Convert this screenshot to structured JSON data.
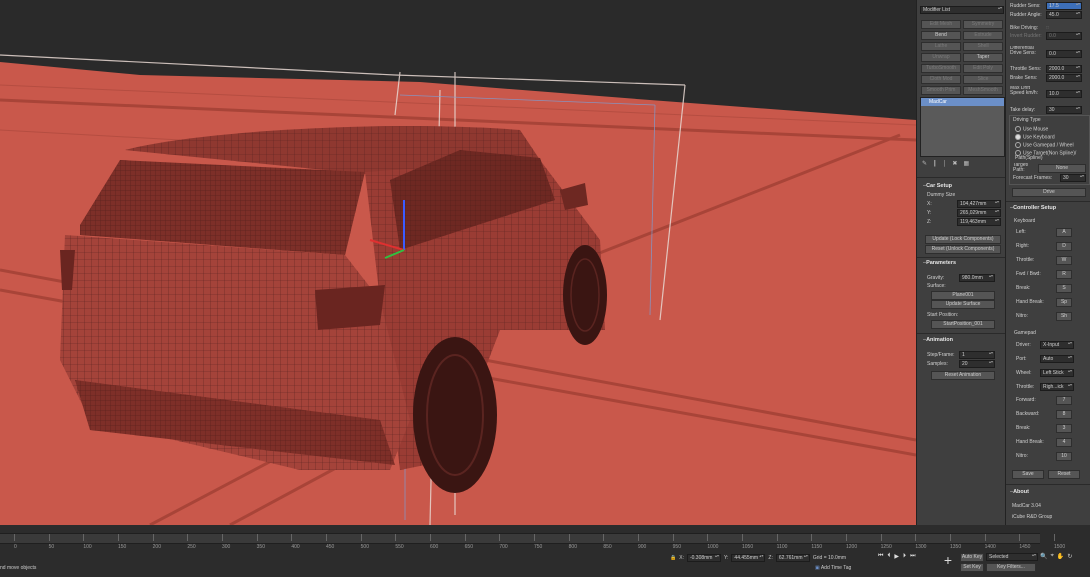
{
  "modifier_panel": {
    "modifier_list_label": "Modifier List",
    "buttons": [
      [
        "Edit Mesh",
        "Symmetry"
      ],
      [
        "Bend",
        "Extrude"
      ],
      [
        "Lathe",
        "Shell"
      ],
      [
        "Unwrap",
        "Taper"
      ],
      [
        "TurboSmooth",
        "Edit Poly"
      ],
      [
        "Cloth Mod",
        "Slice"
      ],
      [
        "Smooth Prim",
        "MeshSmooth"
      ]
    ],
    "stack_item": "MadCar",
    "car_setup": {
      "title": "Car Setup",
      "dummy_size_label": "Dummy Size",
      "x_label": "X:",
      "x_value": "104,427mm",
      "y_label": "Y:",
      "y_value": "265,029mm",
      "z_label": "Z:",
      "z_value": "119,463mm",
      "update_btn": "Update (Lock Components)",
      "reset_btn": "Reset (Unlock Components)"
    },
    "parameters": {
      "title": "Parameters",
      "gravity_label": "Gravity:",
      "gravity_value": "980.0mm",
      "surface_label": "Surface:",
      "surface_value": "Plane001",
      "update_surface_btn": "Update Surface",
      "start_position_label": "Start Position:",
      "start_position_value": "StartPosition_001"
    },
    "animation": {
      "title": "Animation",
      "step_frame_label": "Step/Frame:",
      "step_frame_value": "1",
      "samples_label": "Samples:",
      "samples_value": "20",
      "reset_btn": "Reset Animation"
    }
  },
  "right_panel": {
    "rudder_sens_label": "Rudder Sens:",
    "rudder_sens_value": "17.5",
    "rudder_angle_label": "Rudder Angle:",
    "rudder_angle_value": "45.0",
    "bike_driving_label": "Bike Driving:",
    "invert_rudder_label": "Invert Rudder:",
    "invert_rudder_value": "0.0",
    "diff_drive_label": "Differential Drive Sens:",
    "diff_drive_value": "0.0",
    "throttle_sens_label": "Throttle Sens:",
    "throttle_sens_value": "2000.0",
    "brake_sens_label": "Brake Sens:",
    "brake_sens_value": "2000.0",
    "max_drift_label": "Max Drift Speed km/h:",
    "max_drift_value": "10.0",
    "take_delay_label": "Take delay:",
    "take_delay_value": "30",
    "driving_type": {
      "title": "Driving Type",
      "options": [
        "Use Mouse",
        "Use Keyboard",
        "Use Gamepad / Wheel",
        "Use Target(Non Spline)/ Path(Spline)"
      ],
      "selected": 1
    },
    "target_path_label": "Target/ Path:",
    "target_path_value": "None",
    "forecast_frames_label": "Forecast Frames:",
    "forecast_frames_value": "30",
    "drive_btn": "Drive",
    "controller_setup": {
      "title": "Controller Setup",
      "keyboard_label": "Keyboard",
      "keys": [
        {
          "label": "Left:",
          "value": "A"
        },
        {
          "label": "Right:",
          "value": "D"
        },
        {
          "label": "Throttle:",
          "value": "W"
        },
        {
          "label": "Fwd / Bwd:",
          "value": "R"
        },
        {
          "label": "Break:",
          "value": "S"
        },
        {
          "label": "Hand Break:",
          "value": "Sp"
        },
        {
          "label": "Nitro:",
          "value": "Sh"
        }
      ],
      "gamepad_label": "Gamepad",
      "driver_label": "Driver:",
      "driver_value": "X-Input",
      "port_label": "Port:",
      "port_value": "Auto",
      "wheel_label": "Wheel:",
      "wheel_value": "Left Stick",
      "throttle_label": "Throttle:",
      "throttle_value": "Righ...ick",
      "pads": [
        {
          "label": "Forward:",
          "value": "7"
        },
        {
          "label": "Backward:",
          "value": "8"
        },
        {
          "label": "Break:",
          "value": "3"
        },
        {
          "label": "Hand Break:",
          "value": "4"
        },
        {
          "label": "Nitro:",
          "value": "10"
        }
      ],
      "save_btn": "Save",
      "reset_btn": "Reset"
    },
    "about": {
      "title": "About",
      "version": "MadCar 3.04",
      "company": "iCube R&D Group"
    }
  },
  "timeline": {
    "ticks": [
      "0",
      "50",
      "100",
      "150",
      "200",
      "250",
      "300",
      "350",
      "400",
      "450",
      "500",
      "550",
      "600",
      "650",
      "700",
      "750",
      "800",
      "850",
      "900",
      "950",
      "1000",
      "1050",
      "1100",
      "1150",
      "1200",
      "1250",
      "1300",
      "1350",
      "1400",
      "1450",
      "1500"
    ],
    "status_text": "nd move objects",
    "x_value": "-0.308mm",
    "y_value": "44.455mm",
    "z_value": "62.761mm",
    "grid_label": "Grid = 10.0mm",
    "add_time_tag": "Add Time Tag",
    "auto_key": "Auto Key",
    "set_key": "Set Key",
    "selected": "Selected",
    "key_filters": "Key Filters..."
  },
  "colors": {
    "ground": "#c9584b",
    "car_body": "#9a3c34",
    "panel_bg": "#3f3f3f"
  }
}
